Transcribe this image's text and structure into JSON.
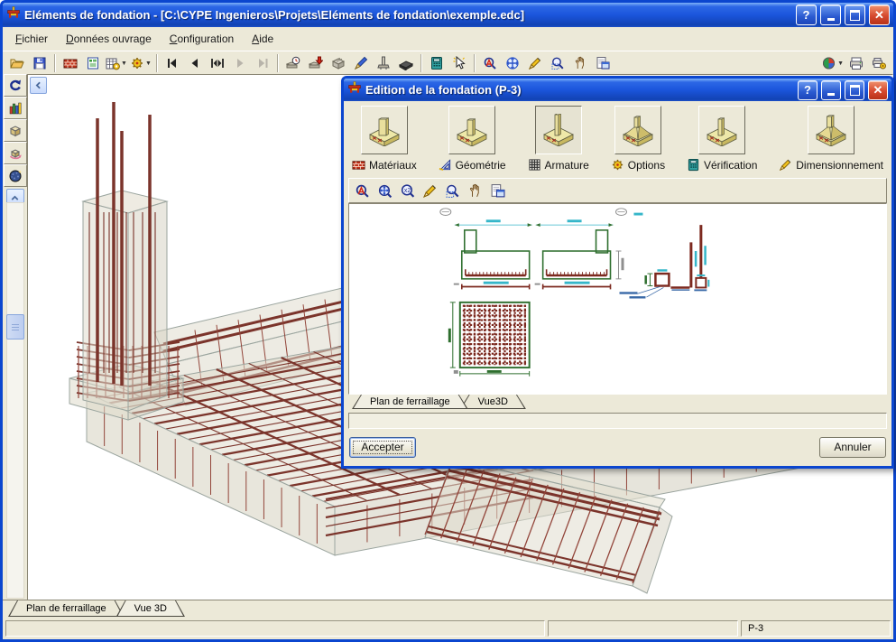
{
  "window": {
    "title": "Eléments de fondation - [C:\\CYPE Ingenieros\\Projets\\Eléments de fondation\\exemple.edc]",
    "controls": {
      "help": "?",
      "minimize": "minimize",
      "maximize": "maximize",
      "close": "close"
    }
  },
  "menu": {
    "items": [
      {
        "label": "Fichier",
        "hotkey": "F"
      },
      {
        "label": "Données ouvrage",
        "hotkey": "D"
      },
      {
        "label": "Configuration",
        "hotkey": "C"
      },
      {
        "label": "Aide",
        "hotkey": "A"
      }
    ]
  },
  "main_toolbar": {
    "groups": [
      [
        {
          "icon": "open-folder"
        },
        {
          "icon": "save"
        }
      ],
      [
        {
          "icon": "project-data"
        },
        {
          "icon": "report"
        },
        {
          "icon": "tables",
          "dropdown": true
        },
        {
          "icon": "settings-gear",
          "dropdown": true
        }
      ],
      [
        {
          "icon": "nav-first"
        },
        {
          "icon": "nav-prev"
        },
        {
          "icon": "nav-range"
        },
        {
          "icon": "nav-next",
          "disabled": true
        },
        {
          "icon": "nav-last",
          "disabled": true
        }
      ],
      [
        {
          "icon": "time-stamp"
        },
        {
          "icon": "import"
        },
        {
          "icon": "surface"
        },
        {
          "icon": "edit-pencil"
        },
        {
          "icon": "column"
        },
        {
          "icon": "foundation"
        }
      ],
      [
        {
          "icon": "calculate"
        },
        {
          "icon": "select"
        }
      ],
      [
        {
          "icon": "zoom-dynamic"
        },
        {
          "icon": "sphere-rotate"
        },
        {
          "icon": "redraw"
        },
        {
          "icon": "zoom-window"
        },
        {
          "icon": "pan"
        },
        {
          "icon": "print-preview"
        }
      ]
    ],
    "right_group": [
      {
        "icon": "world",
        "dropdown": true
      },
      {
        "icon": "printer"
      },
      {
        "icon": "printer-config"
      }
    ]
  },
  "left_toolbar": {
    "items": [
      {
        "icon": "undo"
      },
      {
        "icon": "statistics"
      },
      {
        "icon": "solid-view"
      },
      {
        "icon": "rotate-view"
      },
      {
        "icon": "render-view"
      }
    ]
  },
  "bottom_tabs": {
    "items": [
      {
        "label": "Plan de ferraillage",
        "selected": false
      },
      {
        "label": "Vue 3D",
        "selected": true
      }
    ]
  },
  "status_bar": {
    "panels": [
      "",
      "",
      "P-3"
    ]
  },
  "dialog": {
    "title": "Edition de la fondation (P-3)",
    "controls": {
      "help": "?",
      "minimize": "minimize",
      "maximize": "maximize",
      "close": "close"
    },
    "sections": [
      {
        "label": "Matériaux",
        "icon": "bricks",
        "selected": false
      },
      {
        "label": "Géométrie",
        "icon": "set-square",
        "selected": false
      },
      {
        "label": "Armature",
        "icon": "grid",
        "selected": true
      },
      {
        "label": "Options",
        "icon": "gear",
        "selected": false
      },
      {
        "label": "Vérification",
        "icon": "calculator",
        "selected": false
      },
      {
        "label": "Dimensionnement",
        "icon": "dim-pencil",
        "selected": false
      }
    ],
    "toolbar": [
      {
        "icon": "zoom-dynamic"
      },
      {
        "icon": "zoom-extents"
      },
      {
        "icon": "zoom-x2"
      },
      {
        "icon": "redraw"
      },
      {
        "icon": "zoom-window"
      },
      {
        "icon": "pan"
      },
      {
        "icon": "print-preview"
      }
    ],
    "tabs": [
      {
        "label": "Plan de ferraillage",
        "selected": true
      },
      {
        "label": "Vue3D",
        "selected": false
      }
    ],
    "message": "",
    "buttons": {
      "accept": "Accepter",
      "cancel": "Annuler"
    }
  },
  "colors": {
    "titlebar_blue": "#1b55dc",
    "window_frame": "#0b46cf",
    "beige": "#ece9d8",
    "rebar_maroon": "#7b342b",
    "drawing_green": "#2f6f2f",
    "drawing_red": "#7c291f",
    "dim_cyan": "#35b6c9",
    "leader_blue": "#3a6aa8",
    "close_red": "#d6492f"
  }
}
